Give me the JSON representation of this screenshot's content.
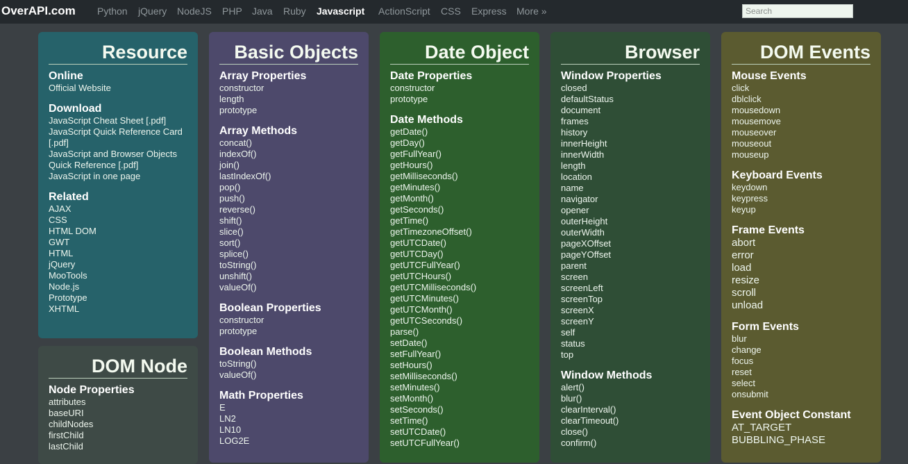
{
  "header": {
    "logo": "OverAPI.com",
    "nav": [
      "Python",
      "jQuery",
      "NodeJS",
      "PHP",
      "Java",
      "Ruby",
      "Javascript",
      "ActionScript",
      "CSS",
      "Express",
      "More »"
    ],
    "active": "Javascript",
    "search_placeholder": "Search"
  },
  "panels": {
    "resource": {
      "title": "Resource",
      "sections": [
        {
          "title": "Online",
          "items": [
            "Official Website"
          ]
        },
        {
          "title": "Download",
          "items": [
            "JavaScript Cheat Sheet [.pdf]",
            "JavaScript Quick Reference Card [.pdf]",
            "JavaScript and Browser Objects Quick Reference [.pdf]",
            "JavaScript in one page"
          ]
        },
        {
          "title": "Related",
          "items": [
            "AJAX",
            "CSS",
            "HTML DOM",
            "GWT",
            "HTML",
            "jQuery",
            "MooTools",
            "Node.js",
            "Prototype",
            "XHTML"
          ]
        }
      ]
    },
    "domnode": {
      "title": "DOM Node",
      "sections": [
        {
          "title": "Node Properties",
          "items": [
            "attributes",
            "baseURI",
            "childNodes",
            "firstChild",
            "lastChild"
          ]
        }
      ]
    },
    "basic": {
      "title": "Basic Objects",
      "sections": [
        {
          "title": "Array Properties",
          "items": [
            "constructor",
            "length",
            "prototype"
          ]
        },
        {
          "title": "Array Methods",
          "items": [
            "concat()",
            "indexOf()",
            "join()",
            "lastIndexOf()",
            "pop()",
            "push()",
            "reverse()",
            "shift()",
            "slice()",
            "sort()",
            "splice()",
            "toString()",
            "unshift()",
            "valueOf()"
          ]
        },
        {
          "title": "Boolean Properties",
          "items": [
            "constructor",
            "prototype"
          ]
        },
        {
          "title": "Boolean Methods",
          "items": [
            "toString()",
            "valueOf()"
          ]
        },
        {
          "title": "Math Properties",
          "items": [
            "E",
            "LN2",
            "LN10",
            "LOG2E"
          ]
        }
      ]
    },
    "date": {
      "title": "Date Object",
      "sections": [
        {
          "title": "Date Properties",
          "items": [
            "constructor",
            "prototype"
          ]
        },
        {
          "title": "Date Methods",
          "items": [
            "getDate()",
            "getDay()",
            "getFullYear()",
            "getHours()",
            "getMilliseconds()",
            "getMinutes()",
            "getMonth()",
            "getSeconds()",
            "getTime()",
            "getTimezoneOffset()",
            "getUTCDate()",
            "getUTCDay()",
            "getUTCFullYear()",
            "getUTCHours()",
            "getUTCMilliseconds()",
            "getUTCMinutes()",
            "getUTCMonth()",
            "getUTCSeconds()",
            "parse()",
            "setDate()",
            "setFullYear()",
            "setHours()",
            "setMilliseconds()",
            "setMinutes()",
            "setMonth()",
            "setSeconds()",
            "setTime()",
            "setUTCDate()",
            "setUTCFullYear()"
          ]
        }
      ]
    },
    "browser": {
      "title": "Browser",
      "sections": [
        {
          "title": "Window Properties",
          "items": [
            "closed",
            "defaultStatus",
            "document",
            "frames",
            "history",
            "innerHeight",
            "innerWidth",
            "length",
            "location",
            "name",
            "navigator",
            "opener",
            "outerHeight",
            "outerWidth",
            "pageXOffset",
            "pageYOffset",
            "parent",
            "screen",
            "screenLeft",
            "screenTop",
            "screenX",
            "screenY",
            "self",
            "status",
            "top"
          ]
        },
        {
          "title": "Window Methods",
          "items": [
            "alert()",
            "blur()",
            "clearInterval()",
            "clearTimeout()",
            "close()",
            "confirm()"
          ]
        }
      ]
    },
    "dom": {
      "title": "DOM Events",
      "sections": [
        {
          "title": "Mouse Events",
          "items": [
            "click",
            "dblclick",
            "mousedown",
            "mousemove",
            "mouseover",
            "mouseout",
            "mouseup"
          ]
        },
        {
          "title": "Keyboard Events",
          "items": [
            "keydown",
            "keypress",
            "keyup"
          ]
        },
        {
          "title": "Frame Events",
          "items": [
            "abort",
            "error",
            "load",
            "resize",
            "scroll",
            "unload"
          ]
        },
        {
          "title": "Form Events",
          "items": [
            "blur",
            "change",
            "focus",
            "reset",
            "select",
            "onsubmit"
          ]
        },
        {
          "title": "Event Object Constant",
          "items": [
            "AT_TARGET",
            "BUBBLING_PHASE"
          ]
        }
      ]
    }
  }
}
